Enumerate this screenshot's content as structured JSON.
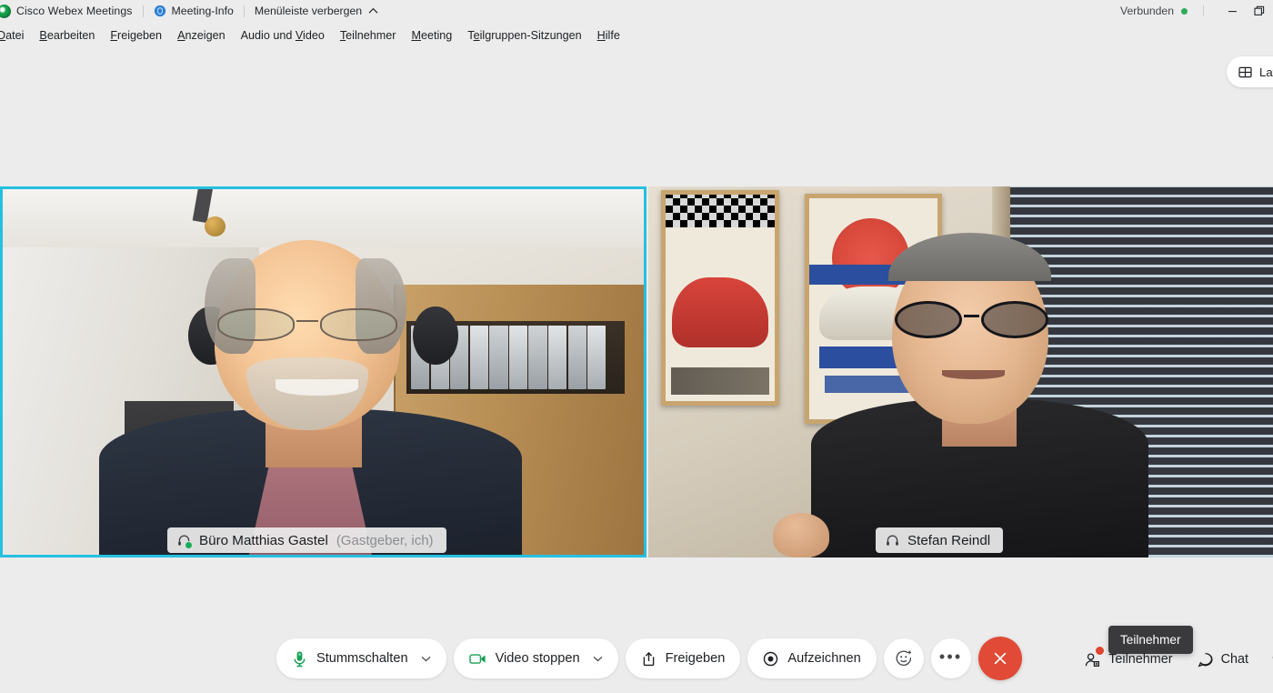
{
  "titlebar": {
    "app_name": "Cisco Webex Meetings",
    "logo_icon": "webex-logo-icon",
    "meeting_info_label": "Meeting-Info",
    "meeting_info_icon": "shield-info-icon",
    "hide_menubar_label": "Menüleiste verbergen",
    "hide_menubar_caret": "chevron-up-icon",
    "connection_status": "Verbunden",
    "connection_color": "#2eab5b",
    "minimize_icon": "minimize-icon",
    "restore_icon": "restore-window-icon"
  },
  "menubar": {
    "items": [
      {
        "label": "Datei",
        "accel_index": 0
      },
      {
        "label": "Bearbeiten",
        "accel_index": 0
      },
      {
        "label": "Freigeben",
        "accel_index": 0
      },
      {
        "label": "Anzeigen",
        "accel_index": 0
      },
      {
        "label": "Audio und Video",
        "accel_index": 10
      },
      {
        "label": "Teilnehmer",
        "accel_index": 0
      },
      {
        "label": "Meeting",
        "accel_index": 0
      },
      {
        "label": "Teilgruppen-Sitzungen",
        "accel_index": 1
      },
      {
        "label": "Hilfe",
        "accel_index": 0
      }
    ]
  },
  "layout_button": {
    "label": "Layo",
    "full_label": "Layout",
    "icon": "grid-layout-icon"
  },
  "stage": {
    "tiles": [
      {
        "name": "Büro Matthias Gastel",
        "role": "(Gastgeber, ich)",
        "audio_icon": "headset-icon",
        "active_speaker": true,
        "active_border_color": "#25c0e0",
        "speaking_dot_color": "#1cab5a"
      },
      {
        "name": "Stefan Reindl",
        "role": "",
        "audio_icon": "headset-icon",
        "active_speaker": false,
        "active_border_color": "",
        "speaking_dot_color": ""
      }
    ]
  },
  "bottombar": {
    "controls": [
      {
        "label": "Stummschalten",
        "icon": "microphone-icon",
        "icon_color": "#1a9e55",
        "has_caret": true
      },
      {
        "label": "Video stoppen",
        "icon": "camera-icon",
        "icon_color": "#1a9e55",
        "has_caret": true
      },
      {
        "label": "Freigeben",
        "icon": "share-upload-icon",
        "icon_color": "#1d1f22",
        "has_caret": false
      },
      {
        "label": "Aufzeichnen",
        "icon": "record-icon",
        "icon_color": "#1d1f22",
        "has_caret": false
      }
    ],
    "reactions": {
      "label": "",
      "icon": "smiley-reaction-icon"
    },
    "more": {
      "label": "•••",
      "icon": "more-options-icon"
    },
    "leave": {
      "label": "",
      "icon": "close-x-icon",
      "color": "#e04a36"
    },
    "right_buttons": [
      {
        "label": "Teilnehmer",
        "icon": "participants-icon",
        "badge": true,
        "badge_color": "#e0452f"
      },
      {
        "label": "Chat",
        "icon": "chat-bubble-icon",
        "badge": false,
        "badge_color": ""
      }
    ],
    "tooltip": "Teilnehmer"
  }
}
